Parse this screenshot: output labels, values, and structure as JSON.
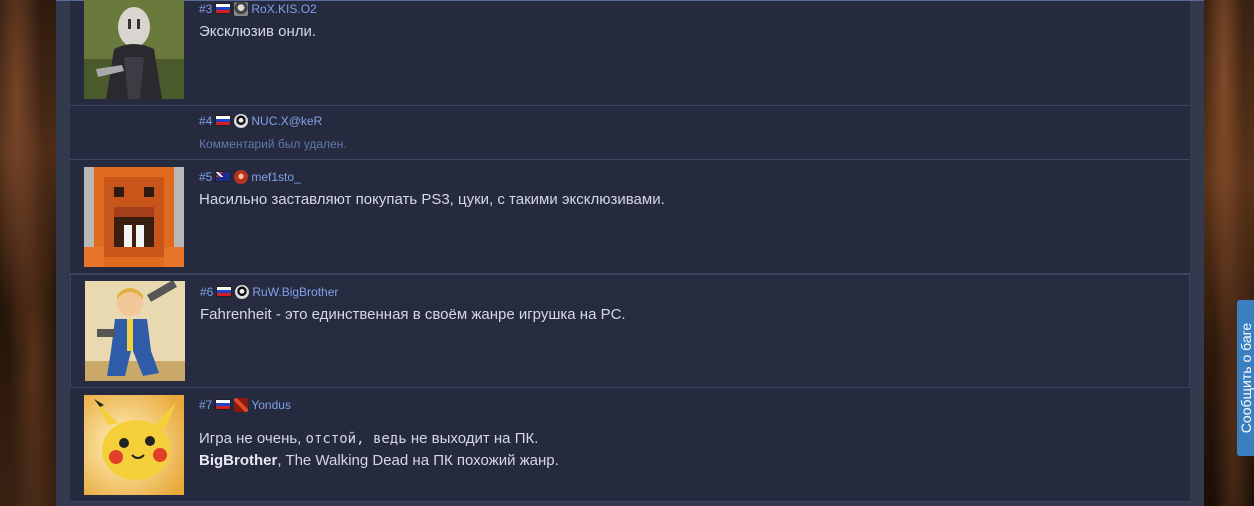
{
  "comments": [
    {
      "number": "#3",
      "flag": "ru",
      "team_icon": "kis-team-icon",
      "username": "RoX.KIS.O2",
      "text": "Эксклюзив онли."
    },
    {
      "number": "#4",
      "flag": "ru",
      "team_icon": "nuc-team-icon",
      "username": "NUC.X@keR",
      "deleted_text": "Комментарий был удален."
    },
    {
      "number": "#5",
      "flag": "au",
      "team_icon": "mef-team-icon",
      "username": "mef1sto_",
      "text": "Насильно заставляют покупать PS3, цуки, с такими эксклюзивами."
    },
    {
      "number": "#6",
      "flag": "ru",
      "team_icon": "ruw-team-icon",
      "username": "RuW.BigBrother",
      "text": "Fahrenheit - это единственная в своём жанре игрушка на PC."
    },
    {
      "number": "#7",
      "flag": "ru",
      "team_icon": "dota-icon",
      "username": "Yondus",
      "text_part1": "Игра не очень, ",
      "text_part2": "отстой, ведь",
      "text_part3": " не выходит на ПК.",
      "reply_name": "BigBrother",
      "reply_text": ", The Walking Dead на ПК похожий жанр."
    }
  ],
  "bug_report": {
    "label": "Сообщить о баге"
  },
  "colors": {
    "accent": "#7fa2e8",
    "panel": "#262a3e",
    "outer": "#343a4e",
    "bug_tab": "#3a7fc0"
  }
}
